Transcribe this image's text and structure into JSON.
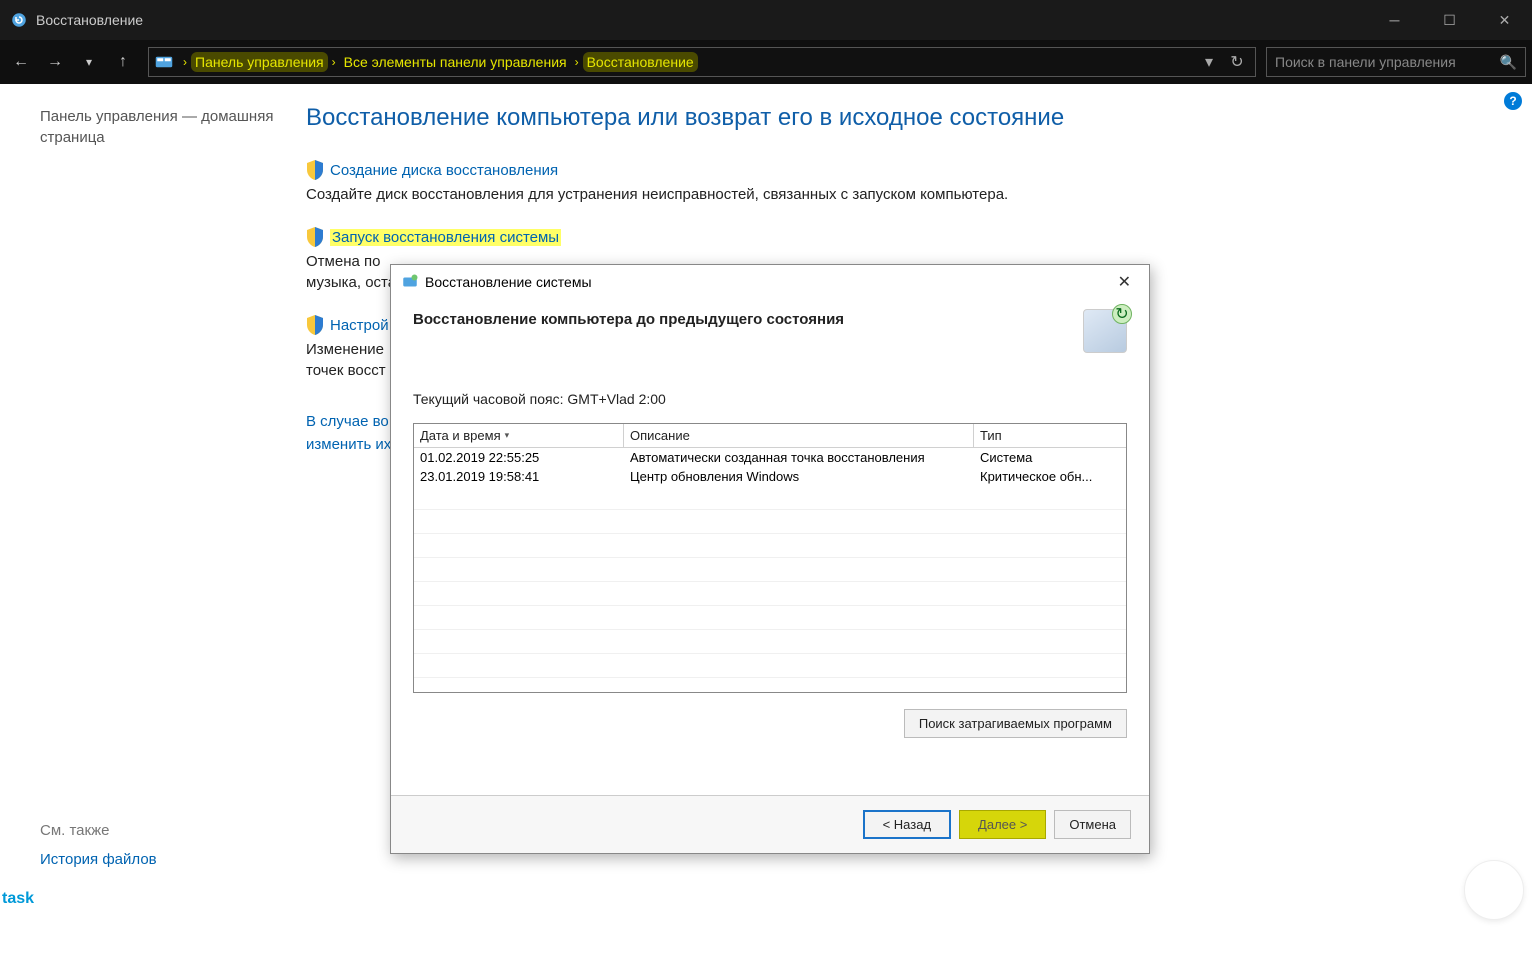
{
  "window": {
    "title": "Восстановление"
  },
  "breadcrumb": {
    "item1": "Панель управления",
    "item2": "Все элементы панели управления",
    "item3": "Восстановление"
  },
  "search": {
    "placeholder": "Поиск в панели управления"
  },
  "sidebar": {
    "home": "Панель управления — домашняя страница",
    "see_also": "См. также",
    "file_history": "История файлов"
  },
  "main": {
    "heading": "Восстановление компьютера или возврат его в исходное состояние",
    "opt1_link": "Создание диска восстановления",
    "opt1_desc": "Создайте диск восстановления для устранения неисправностей, связанных с запуском компьютера.",
    "opt2_link": "Запуск восстановления системы",
    "opt2_desc_a": "Отмена по",
    "opt2_desc_b": "музыка, оста",
    "opt3_link": "Настрой",
    "opt3_desc_a": "Изменение",
    "opt3_desc_b": "точек восст",
    "recovery_a": "В случае во",
    "recovery_b": "изменить их"
  },
  "task_label": "task",
  "dialog": {
    "title": "Восстановление системы",
    "heading": "Восстановление компьютера до предыдущего состояния",
    "timezone": "Текущий часовой пояс: GMT+Vlad 2:00",
    "columns": {
      "dt": "Дата и время",
      "desc": "Описание",
      "type": "Тип"
    },
    "rows": [
      {
        "dt": "01.02.2019 22:55:25",
        "desc": "Автоматически созданная точка восстановления",
        "type": "Система"
      },
      {
        "dt": "23.01.2019 19:58:41",
        "desc": "Центр обновления Windows",
        "type": "Критическое обн..."
      }
    ],
    "affected_btn": "Поиск затрагиваемых программ",
    "back": "< Назад",
    "next": "Далее >",
    "cancel": "Отмена"
  }
}
